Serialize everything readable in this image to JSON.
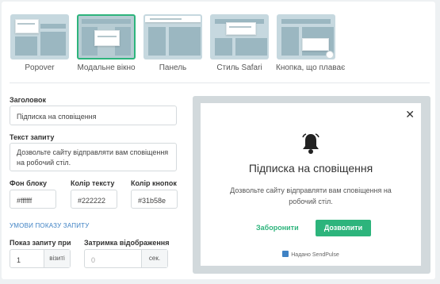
{
  "styles": [
    {
      "label": "Popover",
      "active": false
    },
    {
      "label": "Модальне вікно",
      "active": true
    },
    {
      "label": "Панель",
      "active": false
    },
    {
      "label": "Стиль Safari",
      "active": false
    },
    {
      "label": "Кнопка, що плаває",
      "active": false
    }
  ],
  "form": {
    "title_label": "Заголовок",
    "title_value": "Підписка на сповіщення",
    "text_label": "Текст запиту",
    "text_value": "Дозвольте сайту  відправляти вам сповіщення на робочий стіл.",
    "bg_label": "Фон блоку",
    "bg_value": "#ffffff",
    "text_color_label": "Колір тексту",
    "text_color_value": "#222222",
    "button_color_label": "Колір кнопок",
    "button_color_value": "#31b58e",
    "conditions_link": "УМОВИ ПОКАЗУ ЗАПИТУ",
    "show_label": "Показ запиту при",
    "show_value": "1",
    "show_unit": "візиті",
    "delay_label": "Затримка відображення",
    "delay_placeholder": "0",
    "delay_unit": "сек."
  },
  "preview": {
    "title": "Підписка на сповіщення",
    "text": "Дозвольте сайту відправляти вам сповіщення на робочий стіл.",
    "deny_label": "Заборонити",
    "allow_label": "Дозволити",
    "powered_by": "Надано SendPulse"
  },
  "colors": {
    "accent": "#2db47c",
    "link": "#3f82c4",
    "preview_bg": "#d2d9dc"
  }
}
